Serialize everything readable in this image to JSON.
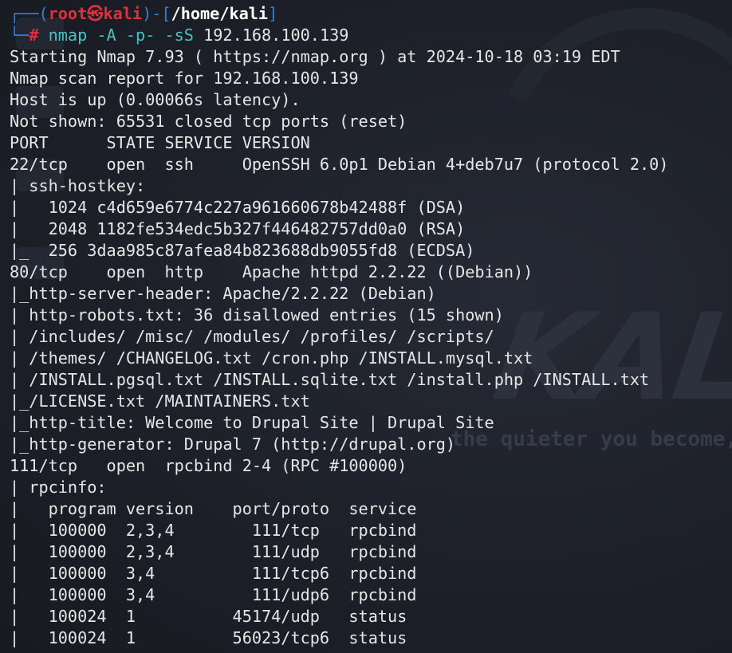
{
  "prompt": {
    "user": "root",
    "host": "kali",
    "cwd": "/home/kali",
    "symbol": "#",
    "at_glyph": "㉿"
  },
  "command": {
    "program": "nmap",
    "args": "-A -p- -sS",
    "target": "192.168.100.139"
  },
  "output_lines": [
    "Starting Nmap 7.93 ( https://nmap.org ) at 2024-10-18 03:19 EDT",
    "Nmap scan report for 192.168.100.139",
    "Host is up (0.00066s latency).",
    "Not shown: 65531 closed tcp ports (reset)",
    "PORT      STATE SERVICE VERSION",
    "22/tcp    open  ssh     OpenSSH 6.0p1 Debian 4+deb7u7 (protocol 2.0)",
    "| ssh-hostkey: ",
    "|   1024 c4d659e6774c227a961660678b42488f (DSA)",
    "|   2048 1182fe534edc5b327f446482757dd0a0 (RSA)",
    "|_  256 3daa985c87afea84b823688db9055fd8 (ECDSA)",
    "80/tcp    open  http    Apache httpd 2.2.22 ((Debian))",
    "|_http-server-header: Apache/2.2.22 (Debian)",
    "| http-robots.txt: 36 disallowed entries (15 shown)",
    "| /includes/ /misc/ /modules/ /profiles/ /scripts/ ",
    "| /themes/ /CHANGELOG.txt /cron.php /INSTALL.mysql.txt ",
    "| /INSTALL.pgsql.txt /INSTALL.sqlite.txt /install.php /INSTALL.txt ",
    "|_/LICENSE.txt /MAINTAINERS.txt",
    "|_http-title: Welcome to Drupal Site | Drupal Site",
    "|_http-generator: Drupal 7 (http://drupal.org)",
    "111/tcp   open  rpcbind 2-4 (RPC #100000)",
    "| rpcinfo: ",
    "|   program version    port/proto  service",
    "|   100000  2,3,4        111/tcp   rpcbind",
    "|   100000  2,3,4        111/udp   rpcbind",
    "|   100000  3,4          111/tcp6  rpcbind",
    "|   100000  3,4          111/udp6  rpcbind",
    "|   100024  1          45174/udp   status",
    "|   100024  1          56023/tcp6  status"
  ],
  "wallpaper": {
    "brand": "KALI",
    "tagline": "the quieter you become,"
  },
  "colors": {
    "background": "#1d2029",
    "text": "#e6e6e6",
    "prompt_frame": "#3a7bd5",
    "prompt_user": "#e0303a",
    "command": "#4bc0c0"
  }
}
